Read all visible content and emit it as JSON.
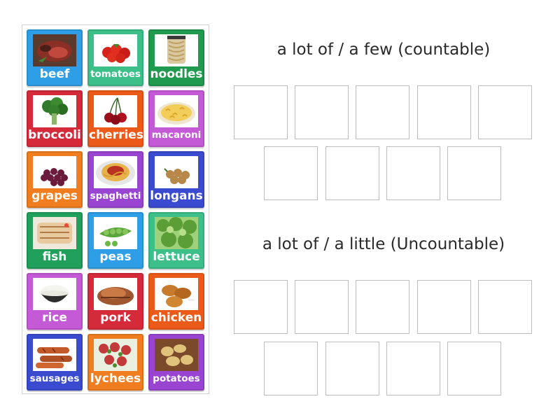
{
  "headings": {
    "countable": "a lot of / a few (countable)",
    "uncountable": "a lot of / a little (Uncountable)"
  },
  "tiles": [
    {
      "label": "beef",
      "color": "#2e9ee6"
    },
    {
      "label": "tomatoes",
      "color": "#3dbf8a"
    },
    {
      "label": "noodles",
      "color": "#1f9a4f"
    },
    {
      "label": "broccoli",
      "color": "#d52a3a"
    },
    {
      "label": "cherries",
      "color": "#ec5a1a"
    },
    {
      "label": "macaroni",
      "color": "#c45ad6"
    },
    {
      "label": "grapes",
      "color": "#f07d1f"
    },
    {
      "label": "spaghetti",
      "color": "#9a45d1"
    },
    {
      "label": "longans",
      "color": "#3a4bd0"
    },
    {
      "label": "fish",
      "color": "#20a05a"
    },
    {
      "label": "peas",
      "color": "#2e9ee6"
    },
    {
      "label": "lettuce",
      "color": "#3dbf8a"
    },
    {
      "label": "rice",
      "color": "#c45ad6"
    },
    {
      "label": "pork",
      "color": "#d52a3a"
    },
    {
      "label": "chicken",
      "color": "#ec5a1a"
    },
    {
      "label": "sausages",
      "color": "#3a4bd0"
    },
    {
      "label": "lychees",
      "color": "#f07d1f"
    },
    {
      "label": "potatoes",
      "color": "#9a45d1"
    }
  ],
  "icons": [
    "beef-icon",
    "tomatoes-icon",
    "noodles-icon",
    "broccoli-icon",
    "cherries-icon",
    "macaroni-icon",
    "grapes-icon",
    "spaghetti-icon",
    "longans-icon",
    "fish-icon",
    "peas-icon",
    "lettuce-icon",
    "rice-icon",
    "pork-icon",
    "chicken-icon",
    "sausages-icon",
    "lychees-icon",
    "potatoes-icon"
  ]
}
